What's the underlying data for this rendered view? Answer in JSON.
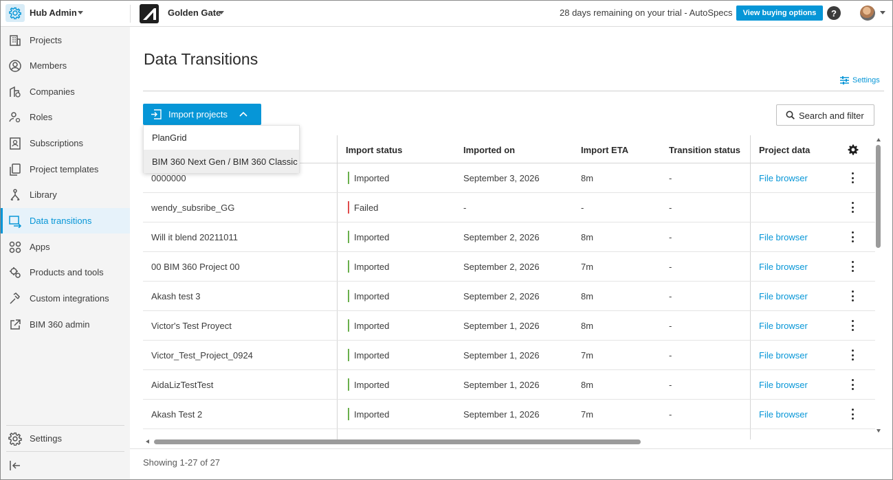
{
  "topbar": {
    "hub_title": "Hub Admin",
    "project_name": "Golden Gate",
    "trial_text": "28 days remaining on your trial - AutoSpecs",
    "buy_label": "View buying options",
    "help_label": "?"
  },
  "sidebar": {
    "items": [
      {
        "label": "Projects",
        "icon": "building-icon"
      },
      {
        "label": "Members",
        "icon": "user-circle-icon"
      },
      {
        "label": "Companies",
        "icon": "companies-icon"
      },
      {
        "label": "Roles",
        "icon": "roles-icon"
      },
      {
        "label": "Subscriptions",
        "icon": "subscriptions-icon"
      },
      {
        "label": "Project templates",
        "icon": "templates-icon"
      },
      {
        "label": "Library",
        "icon": "library-icon"
      },
      {
        "label": "Data transitions",
        "icon": "data-transitions-icon",
        "active": true
      },
      {
        "label": "Apps",
        "icon": "apps-icon"
      },
      {
        "label": "Products and tools",
        "icon": "products-icon"
      },
      {
        "label": "Custom integrations",
        "icon": "integrations-icon"
      },
      {
        "label": "BIM 360 admin",
        "icon": "external-link-icon"
      }
    ],
    "settings_label": "Settings"
  },
  "main": {
    "title": "Data Transitions",
    "settings_link": "Settings",
    "import_button": "Import projects",
    "import_menu": [
      "PlanGrid",
      "BIM 360 Next Gen / BIM 360 Classic"
    ],
    "search_button": "Search and filter",
    "showing_text": "Showing 1-27 of 27"
  },
  "table": {
    "columns": [
      "Import status",
      "Imported on",
      "Import ETA",
      "Transition status",
      "Project data"
    ],
    "rows": [
      {
        "name": "0000000",
        "status": "Imported",
        "imported_on": "September 3, 2026",
        "eta": "8m",
        "transition": "-",
        "data": "File browser"
      },
      {
        "name": "wendy_subsribe_GG",
        "status": "Failed",
        "imported_on": "-",
        "eta": "-",
        "transition": "-",
        "data": ""
      },
      {
        "name": "Will it blend 20211011",
        "status": "Imported",
        "imported_on": "September 2, 2026",
        "eta": "8m",
        "transition": "-",
        "data": "File browser"
      },
      {
        "name": "00 BIM 360 Project 00",
        "status": "Imported",
        "imported_on": "September 2, 2026",
        "eta": "7m",
        "transition": "-",
        "data": "File browser"
      },
      {
        "name": "Akash test 3",
        "status": "Imported",
        "imported_on": "September 2, 2026",
        "eta": "8m",
        "transition": "-",
        "data": "File browser"
      },
      {
        "name": "Victor's Test Proyect",
        "status": "Imported",
        "imported_on": "September 1, 2026",
        "eta": "8m",
        "transition": "-",
        "data": "File browser"
      },
      {
        "name": "Victor_Test_Project_0924",
        "status": "Imported",
        "imported_on": "September 1, 2026",
        "eta": "7m",
        "transition": "-",
        "data": "File browser"
      },
      {
        "name": "AidaLizTestTest",
        "status": "Imported",
        "imported_on": "September 1, 2026",
        "eta": "8m",
        "transition": "-",
        "data": "File browser"
      },
      {
        "name": "Akash Test 2",
        "status": "Imported",
        "imported_on": "September 1, 2026",
        "eta": "7m",
        "transition": "-",
        "data": "File browser"
      }
    ]
  },
  "colors": {
    "accent": "#0696d7",
    "imported": "#6ab04c",
    "failed": "#e04b4b"
  }
}
